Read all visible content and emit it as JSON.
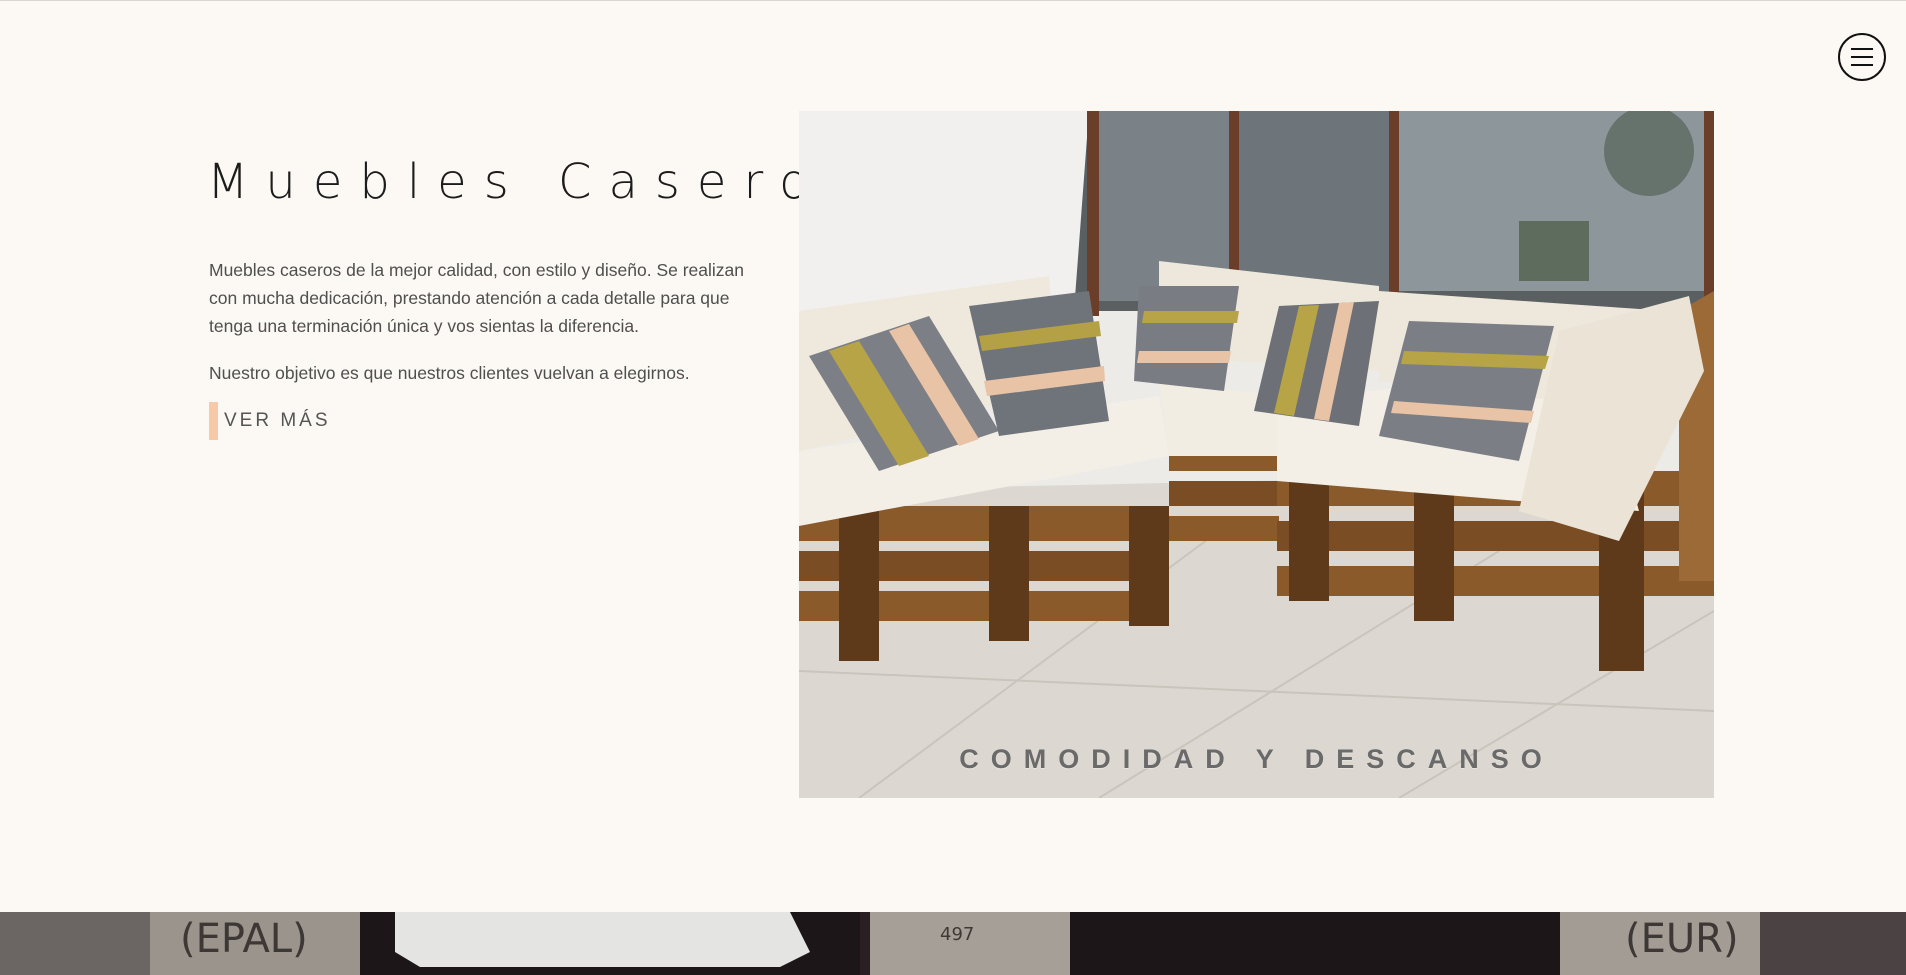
{
  "header": {
    "menu_icon": "hamburger-menu-icon"
  },
  "hero": {
    "title": "Muebles Caseros",
    "paragraph1": "Muebles caseros de la mejor calidad, con estilo y diseño. Se realizan con mucha dedicación, prestando atención a cada detalle para que tenga una terminación única y vos sientas la diferencia.",
    "paragraph2": "Nuestro objetivo es que nuestros clientes vuelvan a elegirnos.",
    "cta_label": "VER MÁS",
    "accent_color": "#f7c9a7"
  },
  "feature_image": {
    "caption": "COMODIDAD Y DESCANSO",
    "subject": "pallet sofa with striped cushions"
  },
  "bottom_strip": {
    "stamp_left": "(EPAL)",
    "stamp_right": "(EUR)",
    "stamp_center": "497"
  }
}
